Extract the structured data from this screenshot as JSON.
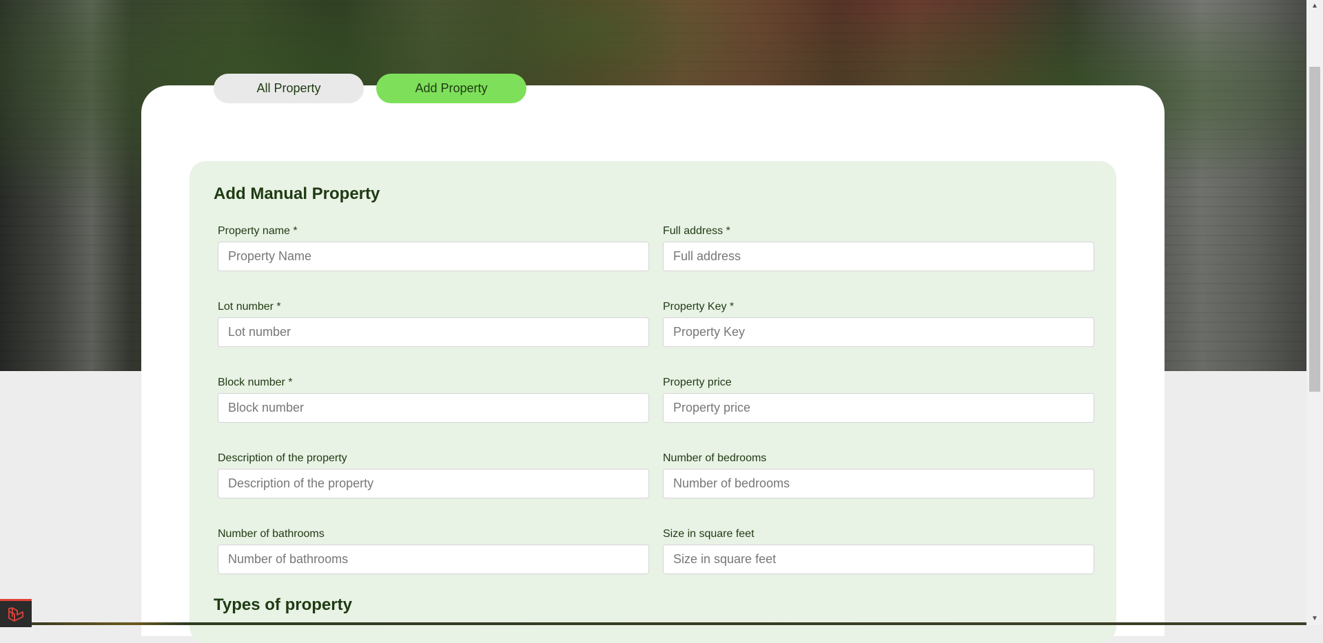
{
  "tabs": {
    "all_property": "All Property",
    "add_property": "Add Property"
  },
  "form": {
    "title": "Add Manual Property",
    "fields": {
      "property_name": {
        "label": "Property name *",
        "placeholder": "Property Name"
      },
      "full_address": {
        "label": "Full address *",
        "placeholder": "Full address"
      },
      "lot_number": {
        "label": "Lot number *",
        "placeholder": "Lot number"
      },
      "property_key": {
        "label": "Property Key *",
        "placeholder": "Property Key"
      },
      "block_number": {
        "label": "Block number *",
        "placeholder": "Block number"
      },
      "property_price": {
        "label": "Property price",
        "placeholder": "Property price"
      },
      "description": {
        "label": "Description of the property",
        "placeholder": "Description of the property"
      },
      "bedrooms": {
        "label": "Number of bedrooms",
        "placeholder": "Number of bedrooms"
      },
      "bathrooms": {
        "label": "Number of bathrooms",
        "placeholder": "Number of bathrooms"
      },
      "size_sqft": {
        "label": "Size in square feet",
        "placeholder": "Size in square feet"
      }
    },
    "types_title": "Types of property"
  },
  "colors": {
    "accent": "#7ee05a",
    "panel": "#e8f2e5",
    "text": "#1f3a12"
  },
  "icons": {
    "debug_badge": "laravel-logo-icon",
    "scroll_up": "chevron-up-icon",
    "scroll_down": "chevron-down-icon"
  }
}
